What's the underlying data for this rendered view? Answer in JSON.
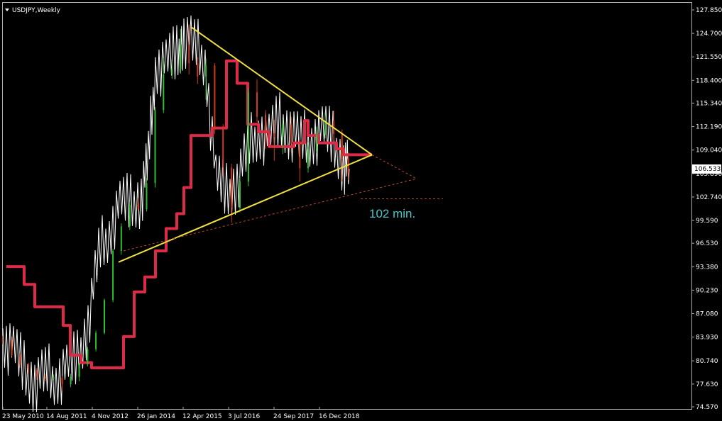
{
  "chart_data": {
    "type": "candlestick",
    "title": "USDJPY,Weekly",
    "background": "#000000",
    "ylim": [
      74.57,
      128.9
    ],
    "y_ticks": [
      "127.850",
      "124.700",
      "121.550",
      "118.400",
      "115.340",
      "112.190",
      "109.040",
      "105.890",
      "102.740",
      "99.590",
      "96.530",
      "93.380",
      "90.230",
      "87.080",
      "83.930",
      "80.740",
      "77.630",
      "74.570"
    ],
    "x_ticks": [
      "23 May 2010",
      "14 Aug 2011",
      "4 Nov 2012",
      "26 Jan 2014",
      "12 Apr 2015",
      "3 Jul 2016",
      "24 Sep 2017",
      "16 Dec 2018"
    ],
    "current_price": "106.533",
    "annotation": "102 min.",
    "colors": {
      "bull": "#2ec02e",
      "bear": "#d23a14",
      "line": "#ffffff",
      "cloud_line": "#dc2a48",
      "triangle": "#f0e040",
      "projection": "#b84d2a"
    },
    "series": [
      {
        "name": "",
        "type": "line",
        "color": "#ffffff",
        "points": [
          [
            0,
            83.6
          ],
          [
            15,
            82.5
          ],
          [
            30,
            79.2
          ],
          [
            45,
            78.0
          ],
          [
            60,
            79.0
          ],
          [
            75,
            78.3
          ],
          [
            90,
            80.0
          ],
          [
            105,
            80.6
          ],
          [
            120,
            86.0
          ],
          [
            135,
            95.0
          ],
          [
            150,
            98.0
          ],
          [
            165,
            102.0
          ],
          [
            180,
            101.5
          ],
          [
            195,
            103.0
          ],
          [
            205,
            108.0
          ],
          [
            215,
            120.0
          ],
          [
            230,
            121.0
          ],
          [
            245,
            121.5
          ],
          [
            255,
            124.5
          ],
          [
            270,
            123.0
          ],
          [
            285,
            121.0
          ],
          [
            300,
            105.5
          ],
          [
            315,
            103.0
          ],
          [
            330,
            105.0
          ],
          [
            345,
            109.0
          ],
          [
            360,
            111.5
          ],
          [
            375,
            111.0
          ],
          [
            390,
            112.5
          ],
          [
            405,
            112.0
          ],
          [
            420,
            110.0
          ],
          [
            435,
            110.5
          ],
          [
            450,
            112.0
          ],
          [
            465,
            110.0
          ],
          [
            480,
            107.5
          ],
          [
            488,
            106.5
          ]
        ]
      },
      {
        "name": "",
        "type": "step",
        "color": "#dc2a48",
        "points": [
          [
            5,
            93.4
          ],
          [
            20,
            93.4
          ],
          [
            30,
            91.0
          ],
          [
            45,
            88.0
          ],
          [
            70,
            88.0
          ],
          [
            85,
            85.5
          ],
          [
            95,
            81.5
          ],
          [
            110,
            80.5
          ],
          [
            125,
            79.8
          ],
          [
            160,
            79.8
          ],
          [
            170,
            84.0
          ],
          [
            185,
            90.0
          ],
          [
            200,
            92.0
          ],
          [
            215,
            95.5
          ],
          [
            230,
            98.5
          ],
          [
            245,
            100.5
          ],
          [
            255,
            104.0
          ],
          [
            265,
            111.0
          ],
          [
            295,
            112.0
          ],
          [
            315,
            121.0
          ],
          [
            325,
            121.0
          ],
          [
            330,
            118.0
          ],
          [
            345,
            112.5
          ],
          [
            360,
            111.5
          ],
          [
            375,
            109.5
          ],
          [
            395,
            109.5
          ],
          [
            410,
            110.0
          ],
          [
            425,
            113.0
          ],
          [
            430,
            111.0
          ],
          [
            445,
            110.0
          ],
          [
            470,
            109.2
          ],
          [
            480,
            108.4
          ],
          [
            520,
            108.4
          ]
        ]
      }
    ],
    "candles": [
      [
        -0.3,
        83.6,
        83.5,
        84.1,
        83.0
      ],
      [
        12.4,
        83.5,
        81.6,
        84.0,
        81.3
      ],
      [
        24.2,
        81.6,
        80.2,
        81.8,
        79.8
      ],
      [
        36.0,
        80.2,
        79.5,
        80.5,
        78.9
      ],
      [
        47.9,
        79.5,
        78.6,
        79.8,
        78.2
      ],
      [
        59.9,
        78.6,
        78.4,
        79.0,
        78.0
      ],
      [
        71.6,
        78.4,
        78.5,
        78.9,
        78.1
      ],
      [
        83.6,
        78.5,
        77.6,
        78.7,
        76.7
      ],
      [
        95.6,
        77.6,
        78.6,
        79.0,
        77.2
      ],
      [
        107.6,
        78.6,
        80.3,
        80.5,
        78.0
      ],
      [
        119.4,
        80.3,
        82.3,
        82.6,
        80.0
      ],
      [
        131.1,
        82.3,
        84.5,
        84.8,
        82.0
      ],
      [
        143.0,
        84.5,
        88.9,
        89.1,
        84.3
      ],
      [
        155.1,
        88.9,
        95.5,
        95.8,
        88.6
      ],
      [
        166.8,
        95.5,
        98.8,
        99.2,
        95.0
      ],
      [
        178.8,
        98.8,
        101.7,
        102.1,
        98.3
      ],
      [
        190.8,
        101.7,
        101.1,
        102.6,
        100.9
      ],
      [
        202.5,
        101.1,
        104.6,
        105.3,
        100.8
      ],
      [
        214.5,
        104.6,
        114.4,
        114.8,
        104.0
      ],
      [
        226.3,
        114.4,
        119.2,
        121.4,
        114.0
      ],
      [
        238.3,
        119.2,
        119.9,
        120.9,
        118.6
      ],
      [
        250.4,
        119.9,
        123.2,
        125.3,
        119.3
      ],
      [
        262.2,
        123.2,
        120.7,
        125.9,
        119.2
      ],
      [
        274.3,
        120.7,
        118.9,
        121.5,
        117.9
      ],
      [
        286.1,
        118.9,
        120.4,
        121.3,
        115.8
      ],
      [
        298.4,
        120.4,
        111.8,
        120.7,
        111.2
      ],
      [
        310.2,
        111.8,
        106.7,
        112.5,
        105.5
      ],
      [
        322.2,
        106.7,
        101.3,
        107.2,
        99.3
      ],
      [
        334.0,
        101.3,
        104.8,
        105.3,
        100.7
      ],
      [
        345.9,
        104.8,
        116.8,
        117.4,
        104.2
      ],
      [
        358.0,
        116.8,
        113.5,
        118.5,
        112.8
      ],
      [
        370.1,
        113.5,
        111.3,
        114.4,
        109.2
      ],
      [
        382.3,
        111.3,
        110.8,
        113.1,
        107.6
      ],
      [
        394.3,
        110.8,
        112.5,
        113.2,
        108.5
      ],
      [
        406.2,
        112.5,
        109.9,
        113.5,
        108.8
      ],
      [
        418.3,
        109.9,
        106.6,
        110.4,
        104.8
      ],
      [
        430.0,
        106.6,
        109.2,
        110.1,
        106.0
      ],
      [
        442.1,
        109.2,
        111.1,
        112.2,
        108.6
      ],
      [
        454.0,
        111.1,
        113.0,
        114.1,
        110.6
      ],
      [
        466.0,
        113.0,
        111.2,
        114.3,
        110.3
      ],
      [
        477.8,
        111.2,
        107.9,
        111.8,
        104.8
      ],
      [
        486.6,
        107.9,
        106.0,
        108.7,
        105.0
      ]
    ],
    "triangle": {
      "upper": [
        [
          266,
          125.5
        ],
        [
          520,
          108.4
        ]
      ],
      "lower": [
        [
          163,
          94.0
        ],
        [
          520,
          108.4
        ]
      ],
      "upper_ext": [
        [
          520,
          108.4
        ],
        [
          583,
          105.2
        ]
      ],
      "lower_ext": [
        [
          170,
          95.5
        ],
        [
          583,
          105.2
        ]
      ],
      "min_line": [
        [
          504,
          102.5
        ],
        [
          620,
          102.5
        ]
      ]
    }
  }
}
